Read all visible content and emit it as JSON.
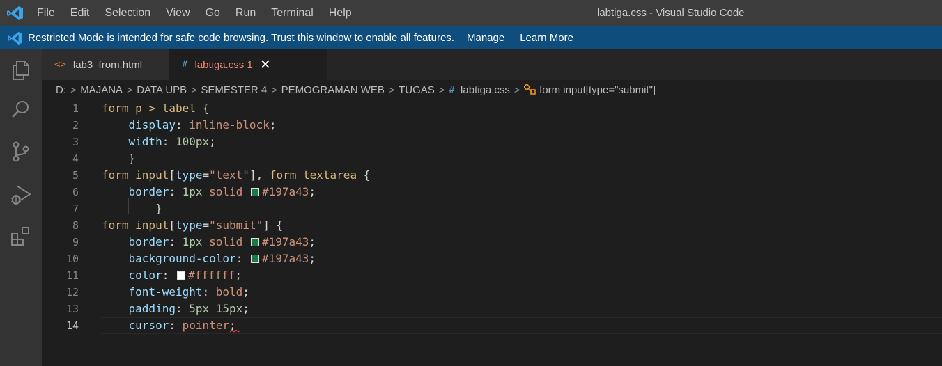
{
  "menu": [
    "File",
    "Edit",
    "Selection",
    "View",
    "Go",
    "Run",
    "Terminal",
    "Help"
  ],
  "window_title": "labtiga.css - Visual Studio Code",
  "banner": {
    "text": "Restricted Mode is intended for safe code browsing. Trust this window to enable all features.",
    "manage": "Manage",
    "learn_more": "Learn More"
  },
  "activity_icons": [
    "explorer-icon",
    "search-icon",
    "source-control-icon",
    "run-debug-icon",
    "extensions-icon"
  ],
  "tabs": [
    {
      "glyph": "<>",
      "label": "lab3_from.html",
      "color": "#cccccc",
      "glyph_color": "#e37933"
    },
    {
      "glyph": "#",
      "label": "labtiga.css 1",
      "color": "#f48771",
      "glyph_color": "#519aba",
      "close": "✕"
    }
  ],
  "breadcrumb": {
    "path": [
      "D:",
      "MAJANA",
      "DATA UPB",
      "SEMESTER 4",
      "PEMOGRAMAN WEB",
      "TUGAS"
    ],
    "file": "labtiga.css",
    "symbol": "form input[type=\"submit\"]"
  },
  "colors": {
    "swatch_green": "#197a43",
    "swatch_white": "#ffffff"
  },
  "code": {
    "current_line": 14,
    "lines": [
      {
        "n": "1",
        "tokens": [
          [
            "sel",
            "form p > label"
          ],
          [
            "punc",
            " {"
          ]
        ]
      },
      {
        "n": "2",
        "tokens": [
          [
            "ws",
            "    "
          ],
          [
            "prop",
            "display"
          ],
          [
            "punc",
            ": "
          ],
          [
            "val",
            "inline-block"
          ],
          [
            "punc",
            ";"
          ]
        ]
      },
      {
        "n": "3",
        "tokens": [
          [
            "ws",
            "    "
          ],
          [
            "prop",
            "width"
          ],
          [
            "punc",
            ": "
          ],
          [
            "num",
            "100px"
          ],
          [
            "punc",
            ";"
          ]
        ]
      },
      {
        "n": "4",
        "tokens": [
          [
            "ws",
            "    "
          ],
          [
            "punc",
            "}"
          ]
        ]
      },
      {
        "n": "5",
        "tokens": [
          [
            "sel",
            "form input"
          ],
          [
            "punc",
            "["
          ],
          [
            "prop",
            "type"
          ],
          [
            "punc",
            "="
          ],
          [
            "val",
            "\"text\""
          ],
          [
            "punc",
            "], "
          ],
          [
            "sel",
            "form textarea"
          ],
          [
            "punc",
            " {"
          ]
        ]
      },
      {
        "n": "6",
        "tokens": [
          [
            "ws",
            "    "
          ],
          [
            "prop",
            "border"
          ],
          [
            "punc",
            ": "
          ],
          [
            "num",
            "1px"
          ],
          [
            "punc",
            " "
          ],
          [
            "val",
            "solid"
          ],
          [
            "punc",
            " "
          ],
          [
            "swatch",
            "#197a43"
          ],
          [
            "val",
            "#197a43"
          ],
          [
            "punc",
            ";"
          ]
        ]
      },
      {
        "n": "7",
        "tokens": [
          [
            "ws",
            "        "
          ],
          [
            "punc",
            "}"
          ]
        ]
      },
      {
        "n": "8",
        "tokens": [
          [
            "sel",
            "form input"
          ],
          [
            "punc",
            "["
          ],
          [
            "prop",
            "type"
          ],
          [
            "punc",
            "="
          ],
          [
            "val",
            "\"submit\""
          ],
          [
            "punc",
            "] {"
          ]
        ]
      },
      {
        "n": "9",
        "tokens": [
          [
            "ws",
            "    "
          ],
          [
            "prop",
            "border"
          ],
          [
            "punc",
            ": "
          ],
          [
            "num",
            "1px"
          ],
          [
            "punc",
            " "
          ],
          [
            "val",
            "solid"
          ],
          [
            "punc",
            " "
          ],
          [
            "swatch",
            "#197a43"
          ],
          [
            "val",
            "#197a43"
          ],
          [
            "punc",
            ";"
          ]
        ]
      },
      {
        "n": "10",
        "tokens": [
          [
            "ws",
            "    "
          ],
          [
            "prop",
            "background-color"
          ],
          [
            "punc",
            ": "
          ],
          [
            "swatch",
            "#197a43"
          ],
          [
            "val",
            "#197a43"
          ],
          [
            "punc",
            ";"
          ]
        ]
      },
      {
        "n": "11",
        "tokens": [
          [
            "ws",
            "    "
          ],
          [
            "prop",
            "color"
          ],
          [
            "punc",
            ": "
          ],
          [
            "swatch",
            "#ffffff"
          ],
          [
            "val",
            "#ffffff"
          ],
          [
            "punc",
            ";"
          ]
        ]
      },
      {
        "n": "12",
        "tokens": [
          [
            "ws",
            "    "
          ],
          [
            "prop",
            "font-weight"
          ],
          [
            "punc",
            ": "
          ],
          [
            "val",
            "bold"
          ],
          [
            "punc",
            ";"
          ]
        ]
      },
      {
        "n": "13",
        "tokens": [
          [
            "ws",
            "    "
          ],
          [
            "prop",
            "padding"
          ],
          [
            "punc",
            ": "
          ],
          [
            "num",
            "5px 15px"
          ],
          [
            "punc",
            ";"
          ]
        ]
      },
      {
        "n": "14",
        "tokens": [
          [
            "ws",
            "    "
          ],
          [
            "prop",
            "cursor"
          ],
          [
            "punc",
            ": "
          ],
          [
            "val",
            "pointer"
          ],
          [
            "punc",
            ";"
          ]
        ]
      }
    ]
  }
}
